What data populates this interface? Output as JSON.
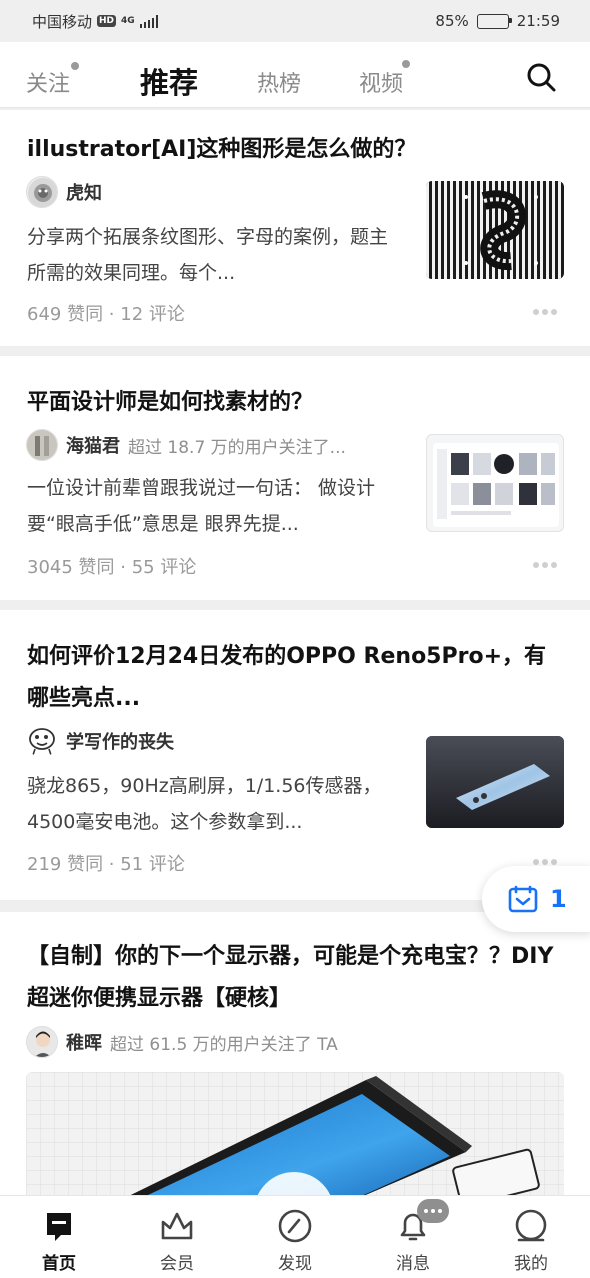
{
  "status_bar": {
    "carrier": "中国移动",
    "hd_label": "HD",
    "network": "4G",
    "battery": "85%",
    "battery_level": 0.85,
    "time": "21:59"
  },
  "top_nav": {
    "tabs": [
      {
        "label": "关注",
        "has_dot": true
      },
      {
        "label": "推荐",
        "active": true
      },
      {
        "label": "热榜"
      },
      {
        "label": "视频",
        "has_dot": true
      }
    ],
    "search_icon": "search-icon"
  },
  "feed": [
    {
      "title": "illustrator[AI]这种图形是怎么做的？",
      "author": "虎知",
      "author_desc": "",
      "excerpt": "分享两个拓展条纹图形、字母的案例，题主所需的效果同理。每个...",
      "meta": "649 赞同 · 12 评论"
    },
    {
      "title": "平面设计师是如何找素材的？",
      "author": "海猫君",
      "author_desc": "超过 18.7 万的用户关注了...",
      "excerpt": "一位设计前辈曾跟我说过一句话： 做设计要“眼高手低”意思是 眼界先提...",
      "meta": "3045 赞同 · 55 评论"
    },
    {
      "title": "如何评价12月24日发布的OPPO Reno5Pro+，有哪些亮点...",
      "author": "学写作的丧失",
      "author_desc": "",
      "excerpt": "骁龙865，90Hz高刷屏，1/1.56传感器，4500毫安电池。这个参数拿到...",
      "meta": "219 赞同 · 51 评论"
    },
    {
      "title": "【自制】你的下一个显示器，可能是个充电宝？？DIY超迷你便携显示器【硬核】",
      "author": "稚晖",
      "author_desc": "超过 61.5 万的用户关注了 TA",
      "excerpt": "",
      "meta": ""
    }
  ],
  "floating_badge": {
    "count": "1",
    "icon": "inbox-icon"
  },
  "tab_bar": {
    "items": [
      {
        "label": "首页",
        "icon": "home-icon",
        "active": true
      },
      {
        "label": "会员",
        "icon": "crown-icon"
      },
      {
        "label": "发现",
        "icon": "compass-icon"
      },
      {
        "label": "消息",
        "icon": "bell-icon"
      },
      {
        "label": "我的",
        "icon": "profile-icon"
      }
    ]
  },
  "colors": {
    "accent": "#1772f6",
    "background": "#efefef",
    "card": "#ffffff"
  }
}
